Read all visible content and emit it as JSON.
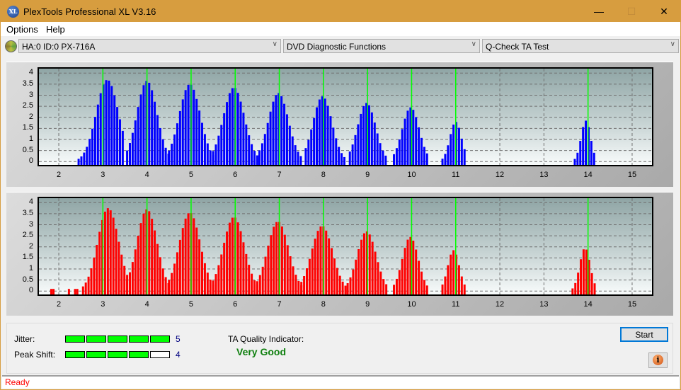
{
  "window": {
    "title": "PlexTools Professional XL V3.16",
    "app_icon_text": "XL",
    "controls": {
      "minimize": "—",
      "maximize": "☐",
      "close": "✕"
    }
  },
  "menu": {
    "items": [
      {
        "label": "Options"
      },
      {
        "label": "Help"
      }
    ]
  },
  "toolbar": {
    "drive_select": "HA:0 ID:0  PX-716A",
    "function_select": "DVD Diagnostic Functions",
    "test_select": "Q-Check TA Test",
    "dropdown_glyph": "∨"
  },
  "chart_data": [
    {
      "type": "bar",
      "name": "TA histogram - upper",
      "color": "#0000ff",
      "marker_color": "#00ff00",
      "xlim": [
        1.55,
        15.45
      ],
      "ylim": [
        -0.15,
        4.2
      ],
      "x_ticks": [
        "2",
        "3",
        "4",
        "5",
        "6",
        "7",
        "8",
        "9",
        "10",
        "11",
        "12",
        "13",
        "14",
        "15"
      ],
      "y_ticks": [
        "0",
        "0.5",
        "1",
        "1.5",
        "2",
        "2.5",
        "3",
        "3.5",
        "4"
      ],
      "grid": true,
      "markers_x": [
        3,
        4,
        5,
        6,
        7,
        8,
        9,
        10,
        11,
        14
      ],
      "peaks": [
        {
          "center": 3.1,
          "height": 3.7,
          "start": 2.45,
          "end": 3.5
        },
        {
          "center": 4.0,
          "height": 3.65,
          "start": 3.55,
          "end": 4.5
        },
        {
          "center": 4.97,
          "height": 3.5,
          "start": 4.5,
          "end": 5.5
        },
        {
          "center": 5.97,
          "height": 3.35,
          "start": 5.5,
          "end": 6.5
        },
        {
          "center": 6.98,
          "height": 3.1,
          "start": 6.55,
          "end": 7.5
        },
        {
          "center": 7.98,
          "height": 2.95,
          "start": 7.6,
          "end": 8.5
        },
        {
          "center": 8.98,
          "height": 2.65,
          "start": 8.6,
          "end": 9.45
        },
        {
          "center": 9.98,
          "height": 2.45,
          "start": 9.6,
          "end": 10.4
        },
        {
          "center": 11.0,
          "height": 1.8,
          "start": 10.7,
          "end": 11.25
        },
        {
          "center": 13.95,
          "height": 1.85,
          "start": 13.7,
          "end": 14.15
        }
      ]
    },
    {
      "type": "bar",
      "name": "TA histogram - lower",
      "color": "#ff0000",
      "marker_color": "#00ff00",
      "xlim": [
        1.55,
        15.45
      ],
      "ylim": [
        -0.15,
        4.2
      ],
      "x_ticks": [
        "2",
        "3",
        "4",
        "5",
        "6",
        "7",
        "8",
        "9",
        "10",
        "11",
        "12",
        "13",
        "14",
        "15"
      ],
      "y_ticks": [
        "0",
        "0.5",
        "1",
        "1.5",
        "2",
        "2.5",
        "3",
        "3.5",
        "4"
      ],
      "grid": true,
      "markers_x": [
        3,
        4,
        5,
        6,
        7,
        8,
        9,
        10,
        11,
        14
      ],
      "peaks": [
        {
          "center": 3.12,
          "height": 3.75,
          "start": 2.55,
          "end": 3.55
        },
        {
          "center": 4.0,
          "height": 3.7,
          "start": 3.55,
          "end": 4.5
        },
        {
          "center": 4.97,
          "height": 3.55,
          "start": 4.5,
          "end": 5.5
        },
        {
          "center": 5.97,
          "height": 3.35,
          "start": 5.5,
          "end": 6.5
        },
        {
          "center": 6.97,
          "height": 3.15,
          "start": 6.5,
          "end": 7.5
        },
        {
          "center": 7.97,
          "height": 2.95,
          "start": 7.5,
          "end": 8.5
        },
        {
          "center": 8.98,
          "height": 2.7,
          "start": 8.55,
          "end": 9.45
        },
        {
          "center": 9.97,
          "height": 2.45,
          "start": 9.6,
          "end": 10.35
        },
        {
          "center": 10.95,
          "height": 1.85,
          "start": 10.7,
          "end": 11.25
        },
        {
          "center": 13.93,
          "height": 1.95,
          "start": 13.65,
          "end": 14.15
        }
      ],
      "stray_bars": [
        1.83,
        1.88,
        2.23,
        2.37,
        2.42
      ]
    }
  ],
  "metrics": {
    "jitter": {
      "label": "Jitter:",
      "value": "5",
      "filled": 5,
      "total": 5
    },
    "peak_shift": {
      "label": "Peak Shift:",
      "value": "4",
      "filled": 4,
      "total": 5
    },
    "ta_quality_label": "TA Quality Indicator:",
    "ta_quality_value": "Very Good",
    "filled_color": "#00ff00",
    "quality_color": "#108010"
  },
  "buttons": {
    "start": "Start",
    "info": "i"
  },
  "status": {
    "text": "Ready",
    "color": "#ff0000"
  }
}
